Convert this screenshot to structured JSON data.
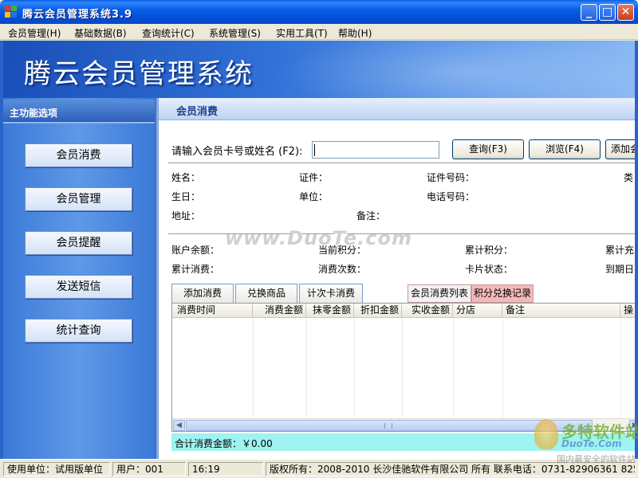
{
  "window": {
    "title": "腾云会员管理系统3.9",
    "minimize_glyph": "_",
    "maximize_glyph": "□",
    "close_glyph": "✕"
  },
  "menu": [
    "会员管理(H)",
    "基础数据(B)",
    "查询统计(C)",
    "系统管理(S)",
    "实用工具(T)",
    "帮助(H)"
  ],
  "banner": {
    "title": "腾云会员管理系统"
  },
  "sidebar": {
    "header": "主功能选项",
    "items": [
      {
        "label": "会员消费"
      },
      {
        "label": "会员管理"
      },
      {
        "label": "会员提醒"
      },
      {
        "label": "发送短信"
      },
      {
        "label": "统计查询"
      }
    ]
  },
  "main": {
    "tab_title": "会员消费",
    "search": {
      "label": "请输入会员卡号或姓名 (F2):",
      "value": "",
      "buttons": [
        "查询(F3)",
        "浏览(F4)",
        "添加会"
      ]
    },
    "info_fields": {
      "name": "姓名：",
      "id_type": "证件：",
      "id_number": "证件号码：",
      "category": "类",
      "birthday": "生日：",
      "unit": "单位：",
      "phone": "电话号码：",
      "address": "地址：",
      "remark": "备注："
    },
    "account_fields": {
      "balance": "账户余额：",
      "current_points": "当前积分：",
      "total_points": "累计积分：",
      "total_recharge": "累计充",
      "total_spend": "累计消费：",
      "spend_count": "消费次数：",
      "card_status": "卡片状态：",
      "expire_date": "到期日"
    },
    "action_buttons": [
      "添加消费",
      "兑换商品",
      "计次卡消费"
    ],
    "list_tabs": [
      "会员消费列表",
      "积分兑换记录"
    ],
    "grid_columns": [
      "消费时间",
      "消费金额",
      "抹零金额",
      "折扣金额",
      "实收金额",
      "分店",
      "备注",
      "操"
    ],
    "grid_rows": [],
    "total": {
      "label": "合计消费金额：",
      "value": "￥0.00"
    }
  },
  "status": {
    "unit": "使用单位：试用版单位",
    "user": "用户：001",
    "time": "16:19",
    "copyright": "版权所有：2008-2010 长沙佳驰软件有限公司 所有 联系电话：0731-82906361 825"
  },
  "watermarks": {
    "center": "www.DuoTe.com",
    "corner_cn": "多特软件站",
    "corner_en": "DuoTe.Com",
    "corner_sub": "国内最安全的软件站"
  },
  "colors": {
    "titlebar": "#0a5ee8",
    "banner": "#2f6fd6",
    "sidebar": "#3a7ad8",
    "total_bar": "#9ff3f0",
    "active_tab": "#f4b8b8"
  }
}
